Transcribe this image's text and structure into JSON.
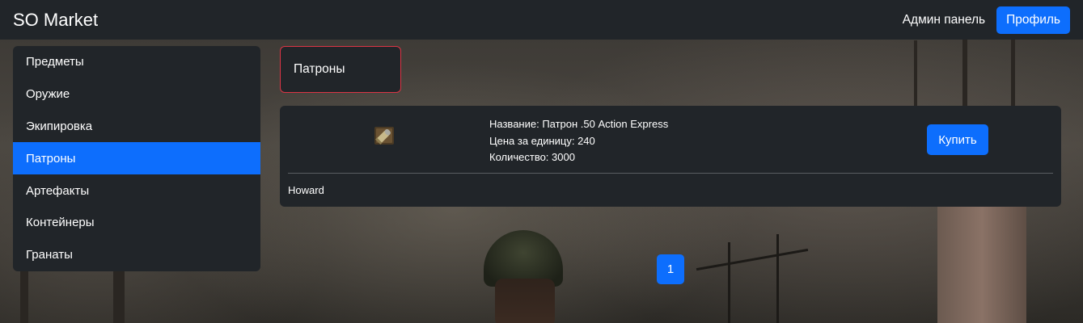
{
  "navbar": {
    "brand": "SO Market",
    "admin_link": "Админ панель",
    "profile_button": "Профиль"
  },
  "sidebar": {
    "items": [
      {
        "label": "Предметы",
        "active": false
      },
      {
        "label": "Оружие",
        "active": false
      },
      {
        "label": "Экипировка",
        "active": false
      },
      {
        "label": "Патроны",
        "active": true
      },
      {
        "label": "Артефакты",
        "active": false
      },
      {
        "label": "Контейнеры",
        "active": false
      },
      {
        "label": "Гранаты",
        "active": false
      }
    ]
  },
  "category": {
    "title": "Патроны"
  },
  "listing": {
    "icon": "ammo-cartridge-icon",
    "name_line": "Название: Патрон .50 Action Express",
    "price_line": "Цена за единицу: 240",
    "quantity_line": "Количество: 3000",
    "buy_button": "Купить",
    "seller": "Howard"
  },
  "pagination": {
    "current_page": "1"
  },
  "colors": {
    "navbar_bg": "#212529",
    "accent": "#0d6efd",
    "category_border": "#dc3545"
  }
}
